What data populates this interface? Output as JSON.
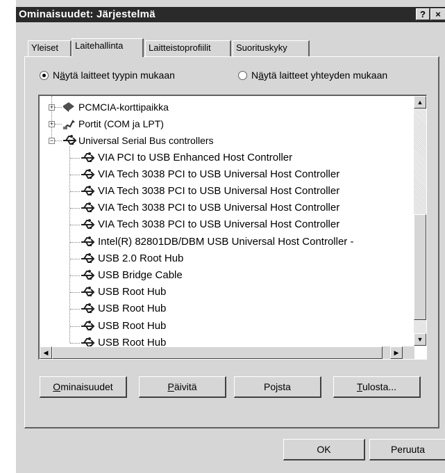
{
  "window": {
    "title": "Ominaisuudet: Järjestelmä",
    "help_glyph": "?",
    "close_glyph": "×"
  },
  "tabs": [
    {
      "label": "Yleiset",
      "active": false
    },
    {
      "label": "Laitehallinta",
      "active": true
    },
    {
      "label": "Laitteistoprofiilit",
      "active": false
    },
    {
      "label": "Suorituskyky",
      "active": false
    }
  ],
  "view_options": {
    "by_type": {
      "prefix": "N",
      "accel": "ä",
      "rest": "ytä laitteet tyypin mukaan",
      "selected": true
    },
    "by_connection": {
      "prefix": "N",
      "accel": "ä",
      "rest": "ytä laitteet yhteyden mukaan",
      "selected": false
    }
  },
  "tree": {
    "categories": [
      {
        "label": "PCMCIA-korttipaikka",
        "icon": "pcmcia-icon",
        "expanded": false
      },
      {
        "label": "Portit (COM ja LPT)",
        "icon": "port-icon",
        "expanded": false
      },
      {
        "label": "Universal Serial Bus controllers",
        "icon": "usb-icon",
        "expanded": true
      }
    ],
    "usb_devices": [
      "VIA PCI to USB Enhanced Host Controller",
      "VIA Tech 3038 PCI to USB Universal Host Controller",
      "VIA Tech 3038 PCI to USB Universal Host Controller",
      "VIA Tech 3038 PCI to USB Universal Host Controller",
      "VIA Tech 3038 PCI to USB Universal Host Controller",
      "Intel(R) 82801DB/DBM USB Universal Host Controller -",
      "USB 2.0 Root Hub",
      "USB Bridge Cable",
      "USB Root Hub",
      "USB Root Hub",
      "USB Root Hub",
      "USB Root Hub"
    ]
  },
  "buttons": {
    "properties": {
      "accel": "O",
      "rest": "minaisuudet"
    },
    "refresh": {
      "accel": "P",
      "rest": "äivitä"
    },
    "remove": {
      "pre": "Po",
      "accel": "j",
      "rest": "sta"
    },
    "print": {
      "accel": "T",
      "rest": "ulosta..."
    },
    "ok": "OK",
    "cancel": "Peruuta"
  },
  "colors": {
    "titlebar": "#2a2a2a",
    "face": "#d6d6d6",
    "shadow": "#606060"
  }
}
